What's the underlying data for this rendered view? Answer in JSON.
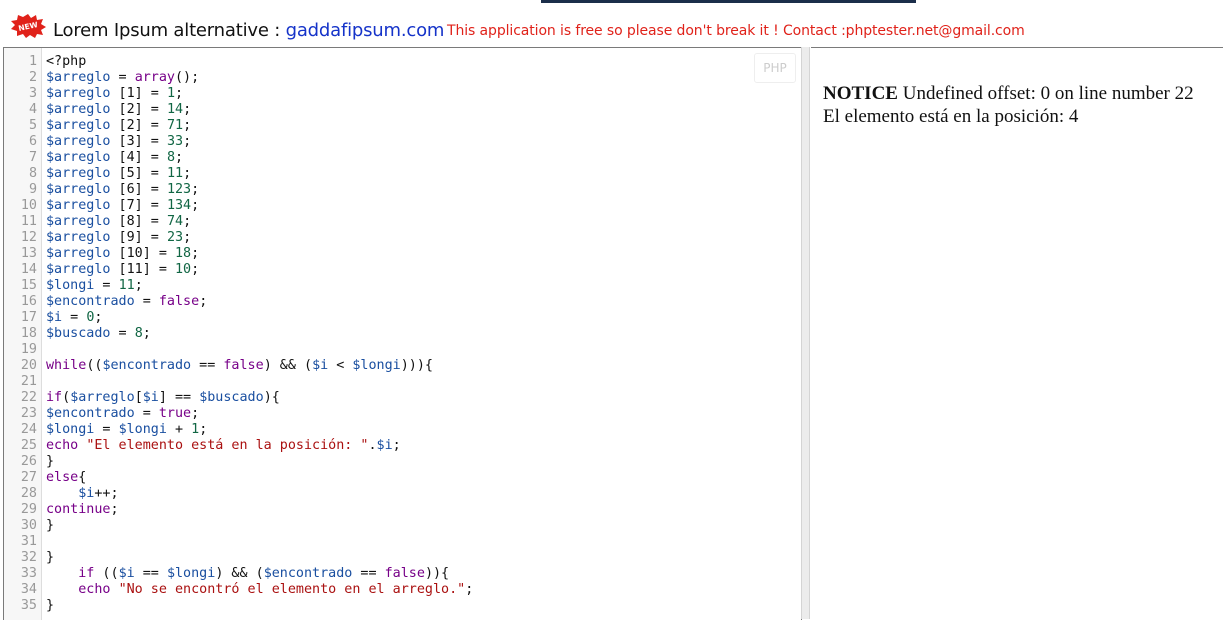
{
  "header": {
    "title_prefix": "Lorem Ipsum alternative : ",
    "title_link": "gaddafipsum.com",
    "badge_text": "NEW",
    "notice": "This application is free so please don't break it ! Contact :phptester.net@gmail.com"
  },
  "editor": {
    "language_badge": "PHP",
    "lines": [
      {
        "n": "1",
        "segs": [
          [
            "t",
            "<?php"
          ]
        ]
      },
      {
        "n": "2",
        "segs": [
          [
            "v",
            "$arreglo"
          ],
          [
            "t",
            " = "
          ],
          [
            "k",
            "array"
          ],
          [
            "t",
            "();"
          ]
        ]
      },
      {
        "n": "3",
        "segs": [
          [
            "v",
            "$arreglo"
          ],
          [
            "t",
            " [1] = "
          ],
          [
            "n",
            "1"
          ],
          [
            "t",
            ";"
          ]
        ]
      },
      {
        "n": "4",
        "segs": [
          [
            "v",
            "$arreglo"
          ],
          [
            "t",
            " [2] = "
          ],
          [
            "n",
            "14"
          ],
          [
            "t",
            ";"
          ]
        ]
      },
      {
        "n": "5",
        "segs": [
          [
            "v",
            "$arreglo"
          ],
          [
            "t",
            " [2] = "
          ],
          [
            "n",
            "71"
          ],
          [
            "t",
            ";"
          ]
        ]
      },
      {
        "n": "6",
        "segs": [
          [
            "v",
            "$arreglo"
          ],
          [
            "t",
            " [3] = "
          ],
          [
            "n",
            "33"
          ],
          [
            "t",
            ";"
          ]
        ]
      },
      {
        "n": "7",
        "segs": [
          [
            "v",
            "$arreglo"
          ],
          [
            "t",
            " [4] = "
          ],
          [
            "n",
            "8"
          ],
          [
            "t",
            ";"
          ]
        ]
      },
      {
        "n": "8",
        "segs": [
          [
            "v",
            "$arreglo"
          ],
          [
            "t",
            " [5] = "
          ],
          [
            "n",
            "11"
          ],
          [
            "t",
            ";"
          ]
        ]
      },
      {
        "n": "9",
        "segs": [
          [
            "v",
            "$arreglo"
          ],
          [
            "t",
            " [6] = "
          ],
          [
            "n",
            "123"
          ],
          [
            "t",
            ";"
          ]
        ]
      },
      {
        "n": "10",
        "segs": [
          [
            "v",
            "$arreglo"
          ],
          [
            "t",
            " [7] = "
          ],
          [
            "n",
            "134"
          ],
          [
            "t",
            ";"
          ]
        ]
      },
      {
        "n": "11",
        "segs": [
          [
            "v",
            "$arreglo"
          ],
          [
            "t",
            " [8] = "
          ],
          [
            "n",
            "74"
          ],
          [
            "t",
            ";"
          ]
        ]
      },
      {
        "n": "12",
        "segs": [
          [
            "v",
            "$arreglo"
          ],
          [
            "t",
            " [9] = "
          ],
          [
            "n",
            "23"
          ],
          [
            "t",
            ";"
          ]
        ]
      },
      {
        "n": "13",
        "segs": [
          [
            "v",
            "$arreglo"
          ],
          [
            "t",
            " [10] = "
          ],
          [
            "n",
            "18"
          ],
          [
            "t",
            ";"
          ]
        ]
      },
      {
        "n": "14",
        "segs": [
          [
            "v",
            "$arreglo"
          ],
          [
            "t",
            " [11] = "
          ],
          [
            "n",
            "10"
          ],
          [
            "t",
            ";"
          ]
        ]
      },
      {
        "n": "15",
        "segs": [
          [
            "v",
            "$longi"
          ],
          [
            "t",
            " = "
          ],
          [
            "n",
            "11"
          ],
          [
            "t",
            ";"
          ]
        ]
      },
      {
        "n": "16",
        "segs": [
          [
            "v",
            "$encontrado"
          ],
          [
            "t",
            " = "
          ],
          [
            "k",
            "false"
          ],
          [
            "t",
            ";"
          ]
        ]
      },
      {
        "n": "17",
        "segs": [
          [
            "v",
            "$i"
          ],
          [
            "t",
            " = "
          ],
          [
            "n",
            "0"
          ],
          [
            "t",
            ";"
          ]
        ]
      },
      {
        "n": "18",
        "segs": [
          [
            "v",
            "$buscado"
          ],
          [
            "t",
            " = "
          ],
          [
            "n",
            "8"
          ],
          [
            "t",
            ";"
          ]
        ]
      },
      {
        "n": "19",
        "segs": []
      },
      {
        "n": "20",
        "segs": [
          [
            "k",
            "while"
          ],
          [
            "t",
            "(("
          ],
          [
            "v",
            "$encontrado"
          ],
          [
            "t",
            " == "
          ],
          [
            "k",
            "false"
          ],
          [
            "t",
            ") && ("
          ],
          [
            "v",
            "$i"
          ],
          [
            "t",
            " < "
          ],
          [
            "v",
            "$longi"
          ],
          [
            "t",
            "))){"
          ]
        ]
      },
      {
        "n": "21",
        "segs": []
      },
      {
        "n": "22",
        "segs": [
          [
            "k",
            "if"
          ],
          [
            "t",
            "("
          ],
          [
            "v",
            "$arreglo"
          ],
          [
            "t",
            "["
          ],
          [
            "v",
            "$i"
          ],
          [
            "t",
            "] == "
          ],
          [
            "v",
            "$buscado"
          ],
          [
            "t",
            "){"
          ]
        ]
      },
      {
        "n": "23",
        "segs": [
          [
            "v",
            "$encontrado"
          ],
          [
            "t",
            " = "
          ],
          [
            "k",
            "true"
          ],
          [
            "t",
            ";"
          ]
        ]
      },
      {
        "n": "24",
        "segs": [
          [
            "v",
            "$longi"
          ],
          [
            "t",
            " = "
          ],
          [
            "v",
            "$longi"
          ],
          [
            "t",
            " + "
          ],
          [
            "n",
            "1"
          ],
          [
            "t",
            ";"
          ]
        ]
      },
      {
        "n": "25",
        "segs": [
          [
            "k",
            "echo"
          ],
          [
            "t",
            " "
          ],
          [
            "s",
            "\"El elemento está en la posición: \""
          ],
          [
            "t",
            "."
          ],
          [
            "v",
            "$i"
          ],
          [
            "t",
            ";"
          ]
        ]
      },
      {
        "n": "26",
        "segs": [
          [
            "t",
            "}"
          ]
        ]
      },
      {
        "n": "27",
        "segs": [
          [
            "k",
            "else"
          ],
          [
            "t",
            "{"
          ]
        ]
      },
      {
        "n": "28",
        "segs": [
          [
            "t",
            "    "
          ],
          [
            "v",
            "$i"
          ],
          [
            "t",
            "++;"
          ]
        ]
      },
      {
        "n": "29",
        "segs": [
          [
            "k",
            "continue"
          ],
          [
            "t",
            ";"
          ]
        ]
      },
      {
        "n": "30",
        "segs": [
          [
            "t",
            "}"
          ]
        ]
      },
      {
        "n": "31",
        "segs": []
      },
      {
        "n": "32",
        "segs": [
          [
            "t",
            "}"
          ]
        ]
      },
      {
        "n": "33",
        "segs": [
          [
            "t",
            "    "
          ],
          [
            "k",
            "if"
          ],
          [
            "t",
            " (("
          ],
          [
            "v",
            "$i"
          ],
          [
            "t",
            " == "
          ],
          [
            "v",
            "$longi"
          ],
          [
            "t",
            ") && ("
          ],
          [
            "v",
            "$encontrado"
          ],
          [
            "t",
            " == "
          ],
          [
            "k",
            "false"
          ],
          [
            "t",
            ")){"
          ]
        ]
      },
      {
        "n": "34",
        "segs": [
          [
            "t",
            "    "
          ],
          [
            "k",
            "echo"
          ],
          [
            "t",
            " "
          ],
          [
            "s",
            "\"No se encontró el elemento en el arreglo.\""
          ],
          [
            "t",
            ";"
          ]
        ]
      },
      {
        "n": "35",
        "segs": [
          [
            "t",
            "}"
          ]
        ]
      }
    ]
  },
  "output": {
    "notice_label": "NOTICE",
    "notice_message": " Undefined offset: 0 on line number 22",
    "result_line": "El elemento está en la posición: 4"
  },
  "colors": {
    "variable": "#1a4fa0",
    "keyword": "#770088",
    "number": "#116644",
    "string": "#aa1111",
    "notice_red": "#e0221a",
    "link_blue": "#1533c9"
  }
}
